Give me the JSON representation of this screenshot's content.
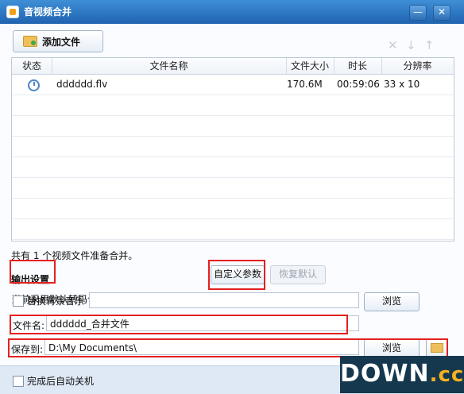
{
  "window": {
    "title": "音视频合并"
  },
  "toolbar": {
    "add_file": "添加文件"
  },
  "table": {
    "headers": [
      "状态",
      "文件名称",
      "文件大小",
      "时长",
      "分辨率"
    ],
    "rows": [
      {
        "name": "dddddd.flv",
        "size": "170.6M",
        "duration": "00:59:06",
        "resolution": "33 x 10"
      }
    ]
  },
  "summary": "共有 1 个视频文件准备合并。",
  "output": {
    "title": "输出设置",
    "note": "当前采用默认转码合并参数，需转码合并。",
    "custom": "自定义参数",
    "restore": "恢复默认",
    "bgm_label": "替换背景音乐",
    "browse": "浏览",
    "filename_label": "文件名:",
    "filename_value": "dddddd_合并文件",
    "save_label": "保存到:",
    "save_value": "D:\\My Documents\\"
  },
  "footer": {
    "shutdown": "完成后自动关机"
  },
  "watermark": {
    "main": "DOWN",
    "suffix": ".cc"
  },
  "icons": [
    "window-app-icon",
    "add-file-folder-icon",
    "remove-x-icon",
    "move-down-icon",
    "move-up-icon",
    "status-clock-icon",
    "folder-open-icon"
  ]
}
